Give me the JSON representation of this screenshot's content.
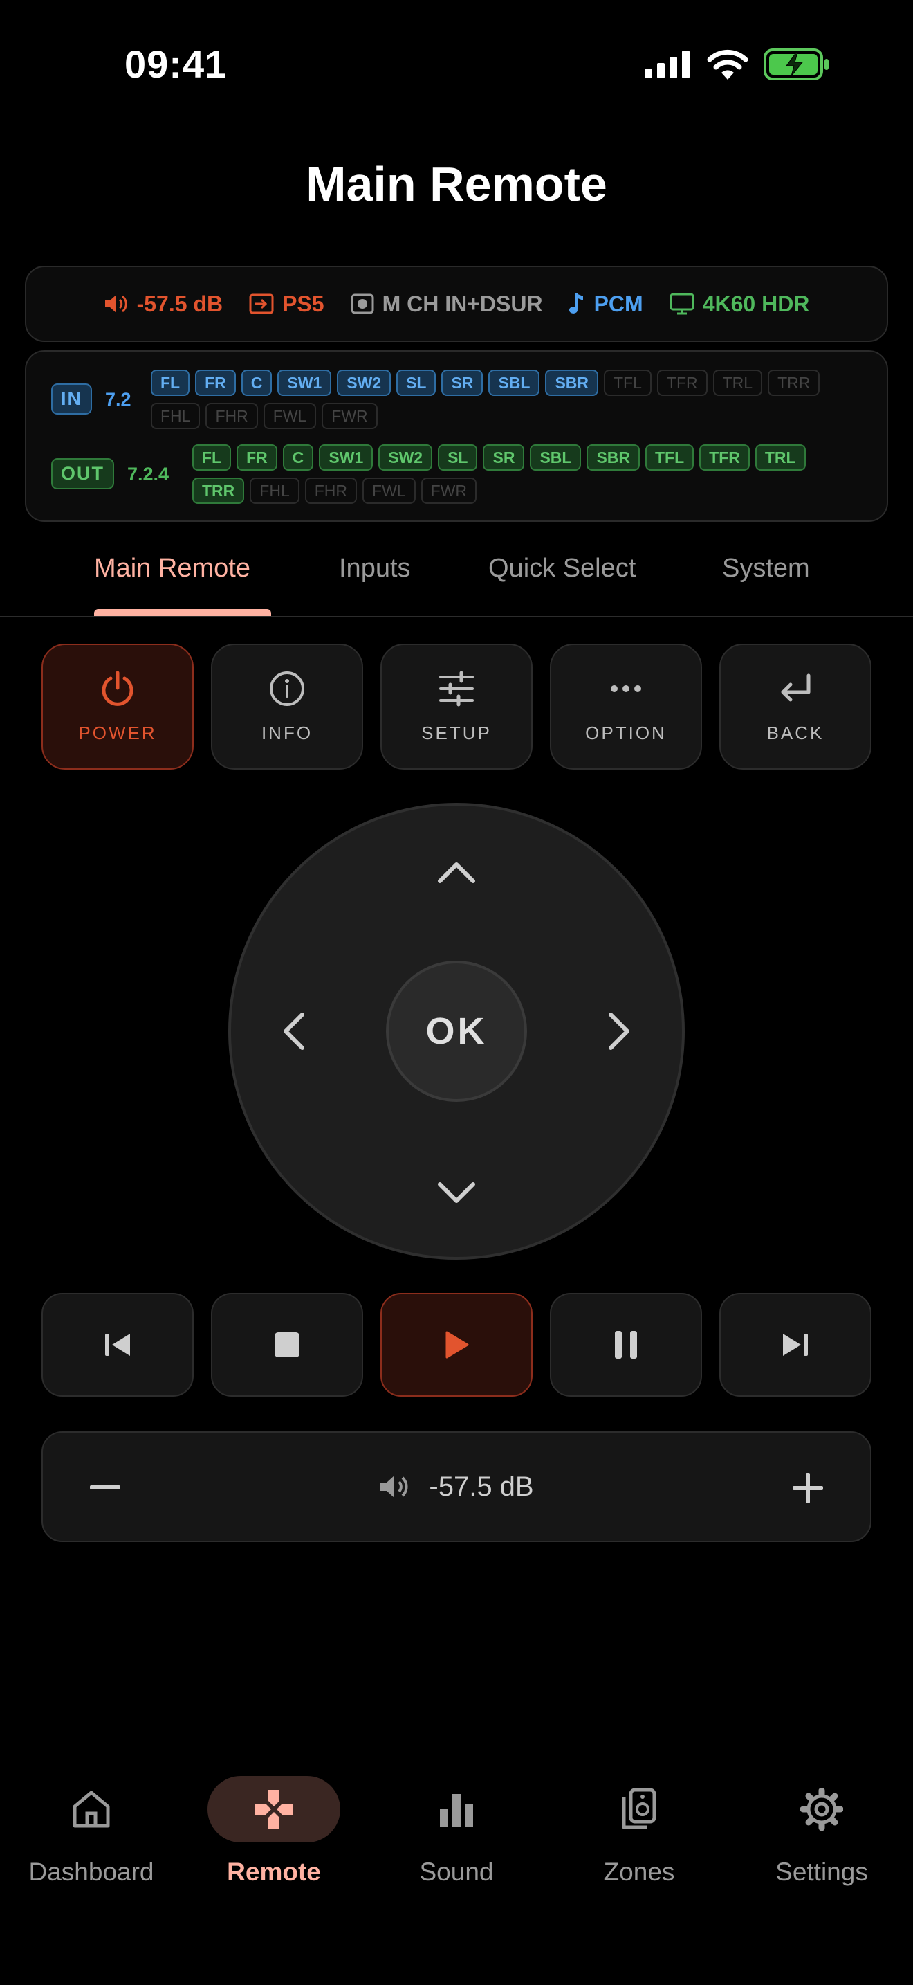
{
  "status_bar": {
    "time": "09:41"
  },
  "page": {
    "title": "Main Remote"
  },
  "now_playing": {
    "volume": "-57.5 dB",
    "source": "PS5",
    "sound_mode": "M CH IN+DSUR",
    "audio_format": "PCM",
    "video_format": "4K60 HDR",
    "colors": {
      "volume": "#e2542e",
      "source": "#e2542e",
      "sound_mode": "#9a9a9a",
      "audio_format": "#4d9ff0",
      "video_format": "#4fb85c"
    }
  },
  "channels": {
    "input": {
      "label": "IN",
      "config": "7.2",
      "active": [
        "FL",
        "FR",
        "C",
        "SW1",
        "SW2",
        "SL",
        "SR",
        "SBL",
        "SBR"
      ],
      "inactive_line1": [
        "TFL",
        "TFR",
        "TRL",
        "TRR"
      ],
      "inactive_line2": [
        "FHL",
        "FHR",
        "FWL",
        "FWR"
      ]
    },
    "output": {
      "label": "OUT",
      "config": "7.2.4",
      "active_line1": [
        "FL",
        "FR",
        "C",
        "SW1",
        "SW2",
        "SL",
        "SR",
        "SBL",
        "SBR",
        "TFL",
        "TFR",
        "TRL"
      ],
      "active_line2": [
        "TRR"
      ],
      "inactive_line2": [
        "FHL",
        "FHR",
        "FWL",
        "FWR"
      ]
    }
  },
  "tabs": [
    {
      "label": "Main Remote",
      "active": true
    },
    {
      "label": "Inputs",
      "active": false
    },
    {
      "label": "Quick Select",
      "active": false
    },
    {
      "label": "System",
      "active": false
    }
  ],
  "function_buttons": [
    {
      "label": "POWER",
      "icon": "power-icon"
    },
    {
      "label": "INFO",
      "icon": "info-icon"
    },
    {
      "label": "SETUP",
      "icon": "sliders-icon"
    },
    {
      "label": "OPTION",
      "icon": "more-horizontal-icon"
    },
    {
      "label": "BACK",
      "icon": "return-icon"
    }
  ],
  "dpad": {
    "ok_label": "OK"
  },
  "transport": [
    "previous-icon",
    "stop-icon",
    "play-icon",
    "pause-icon",
    "next-icon"
  ],
  "volume_control": {
    "value": "-57.5 dB"
  },
  "bottom_nav": [
    {
      "label": "Dashboard",
      "icon": "home-icon",
      "active": false
    },
    {
      "label": "Remote",
      "icon": "gamepad-icon",
      "active": true
    },
    {
      "label": "Sound",
      "icon": "bar-chart-icon",
      "active": false
    },
    {
      "label": "Zones",
      "icon": "speaker-icon",
      "active": false
    },
    {
      "label": "Settings",
      "icon": "gear-icon",
      "active": false
    }
  ],
  "accent_color": "#ffb2a2"
}
